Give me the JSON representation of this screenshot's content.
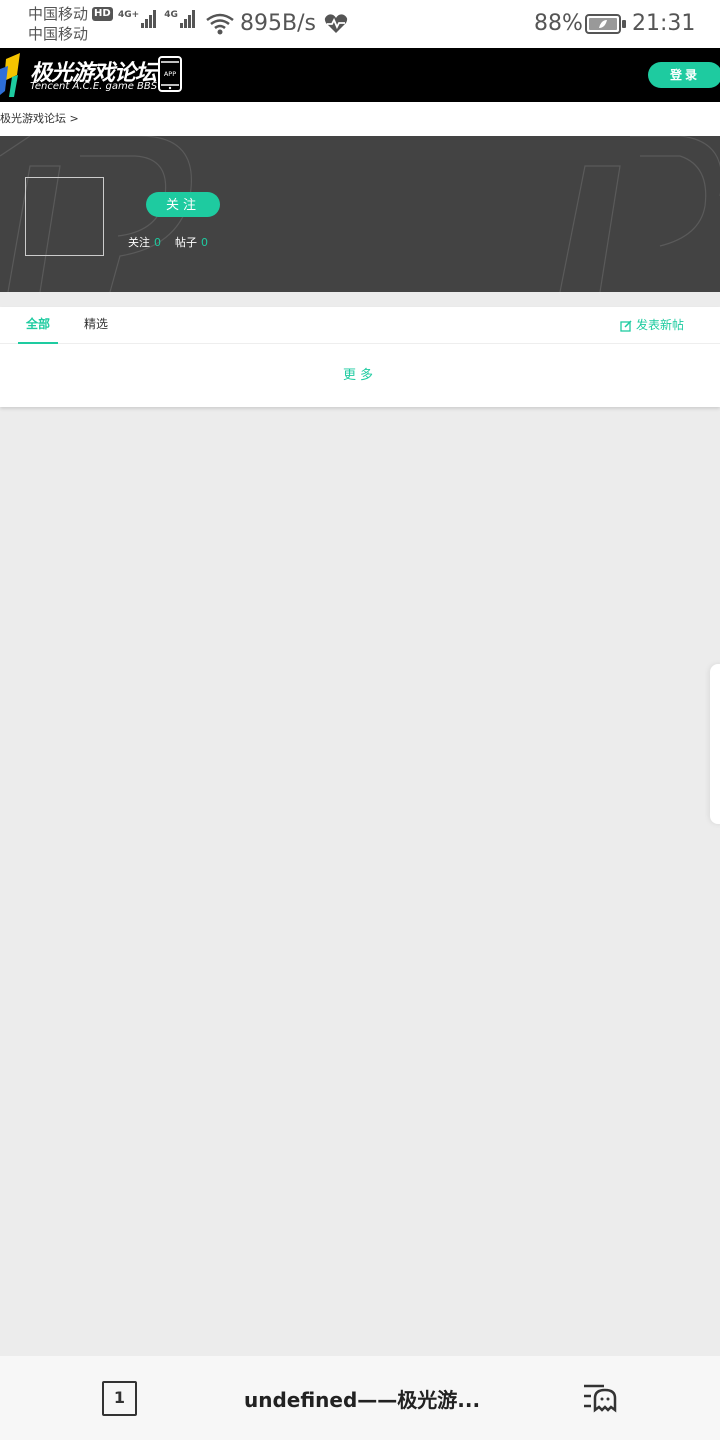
{
  "status_bar": {
    "carrier1": "中国移动",
    "hd": "HD",
    "carrier2": "中国移动",
    "net1": "4G+",
    "net2": "4G",
    "speed": "895B/s",
    "battery": "88%",
    "time": "21:31"
  },
  "header": {
    "logo_title": "极光游戏论坛",
    "logo_subtitle": "Tencent A.C.E. game BBS",
    "app_badge": "APP",
    "login_label": "登录"
  },
  "breadcrumb": {
    "text": "极光游戏论坛 >"
  },
  "profile": {
    "follow_button": "关注",
    "follow_label": "关注",
    "follow_count": "0",
    "posts_label": "帖子",
    "posts_count": "0"
  },
  "tabs": {
    "all": "全部",
    "featured": "精选",
    "new_post": "发表新帖"
  },
  "more_label": "更多",
  "bottom_bar": {
    "tab_count": "1",
    "title": "undefined——极光游..."
  },
  "colors": {
    "accent": "#1ecba0",
    "banner": "#434343",
    "header": "#000000",
    "page_bg": "#ececec"
  }
}
